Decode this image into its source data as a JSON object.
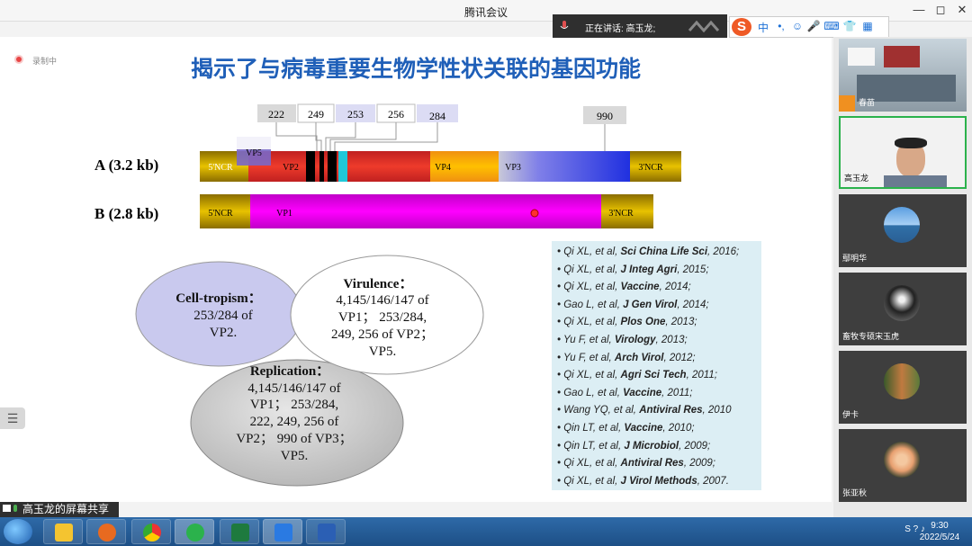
{
  "window": {
    "title": "腾讯会议",
    "controls": [
      "—",
      "◻",
      "✕"
    ]
  },
  "speaker_bar": {
    "text": "正在讲话: 高玉龙;"
  },
  "ime_toolbar": {
    "items": [
      "中",
      "•,",
      "☺",
      "🎤",
      "⌨",
      "👕",
      "▦"
    ]
  },
  "recording": {
    "label": "录制中"
  },
  "slide": {
    "title": "揭示了与病毒重要生物学性状关联的基因功能",
    "segment_a": {
      "label": "A (3.2 kb)",
      "regions": [
        "5'NCR",
        "VP2",
        "VP4",
        "VP3",
        "3'NCR"
      ],
      "vp5": "VP5"
    },
    "segment_b": {
      "label": "B (2.8 kb)",
      "regions": [
        "5'NCR",
        "VP1",
        "3'NCR"
      ]
    },
    "sites": [
      "222",
      "249",
      "253",
      "256",
      "284",
      "990"
    ],
    "ellipse_tropism": {
      "title": "Cell-tropism：",
      "lines": [
        "253/284 of",
        "VP2."
      ]
    },
    "ellipse_virulence": {
      "title": "Virulence：",
      "lines": [
        "4,145/146/147 of",
        "VP1； 253/284,",
        "249, 256 of VP2；",
        "VP5."
      ]
    },
    "ellipse_replication": {
      "title": "Replication：",
      "lines": [
        "4,145/146/147 of",
        "VP1； 253/284,",
        "222, 249, 256 of",
        "VP2； 990 of VP3；",
        "VP5."
      ]
    },
    "references": [
      {
        "a": "Qi XL, et al, ",
        "j": "Sci China Life Sci",
        "y": ", 2016;"
      },
      {
        "a": "Qi XL, et al, ",
        "j": "J Integ Agri",
        "y": ", 2015;"
      },
      {
        "a": "Qi XL, et al, ",
        "j": "Vaccine",
        "y": ", 2014;"
      },
      {
        "a": "Gao L, et al, ",
        "j": "J Gen Virol",
        "y": ", 2014;"
      },
      {
        "a": "Qi XL, et al, ",
        "j": "Plos One",
        "y": ", 2013;"
      },
      {
        "a": "Yu F, et al, ",
        "j": "Virology",
        "y": ", 2013;"
      },
      {
        "a": "Yu F, et al, ",
        "j": "Arch Virol",
        "y": ", 2012;"
      },
      {
        "a": "Qi XL, et al, ",
        "j": "Agri Sci Tech",
        "y": ", 2011;"
      },
      {
        "a": "Gao L, et al, ",
        "j": "Vaccine",
        "y": ", 2011;"
      },
      {
        "a": "Wang YQ, et al, ",
        "j": "Antiviral Res",
        "y": ", 2010"
      },
      {
        "a": "Qin LT, et al, ",
        "j": "Vaccine",
        "y": ", 2010;"
      },
      {
        "a": "Qin LT, et al, ",
        "j": "J Microbiol",
        "y": ", 2009;"
      },
      {
        "a": "Qi XL, et al, ",
        "j": "Antiviral Res",
        "y": ", 2009;"
      },
      {
        "a": "Qi XL, et al, ",
        "j": "J Virol Methods",
        "y": ", 2007."
      }
    ]
  },
  "share_label": "高玉龙的屏幕共享",
  "participants": [
    {
      "name": "春苗",
      "type": "video-room"
    },
    {
      "name": "高玉龙",
      "type": "video-person"
    },
    {
      "name": "鄢明华",
      "type": "avatar-sky"
    },
    {
      "name": "畜牧专硕宋玉虎",
      "type": "avatar-dog"
    },
    {
      "name": "伊卡",
      "type": "avatar-tree"
    },
    {
      "name": "张亚秋",
      "type": "avatar-flower"
    }
  ],
  "taskbar": {
    "apps": [
      "explorer",
      "media-player",
      "chrome",
      "wechat",
      "excel",
      "tencent-meeting",
      "word"
    ],
    "tray_text": "S ? ♪",
    "time": "9:30",
    "date": "2022/5/24"
  },
  "colors": {
    "title_blue": "#1f5fb8",
    "ncr_gold": "#c8a400",
    "vp2_red": "#e03030",
    "vp4_orange": "#f5a020",
    "vp3_blue": "#3040e0",
    "vp1_magenta": "#d000d8",
    "tropism_fill": "#c9c9ee",
    "replication_fill": "#c8c8c8"
  }
}
